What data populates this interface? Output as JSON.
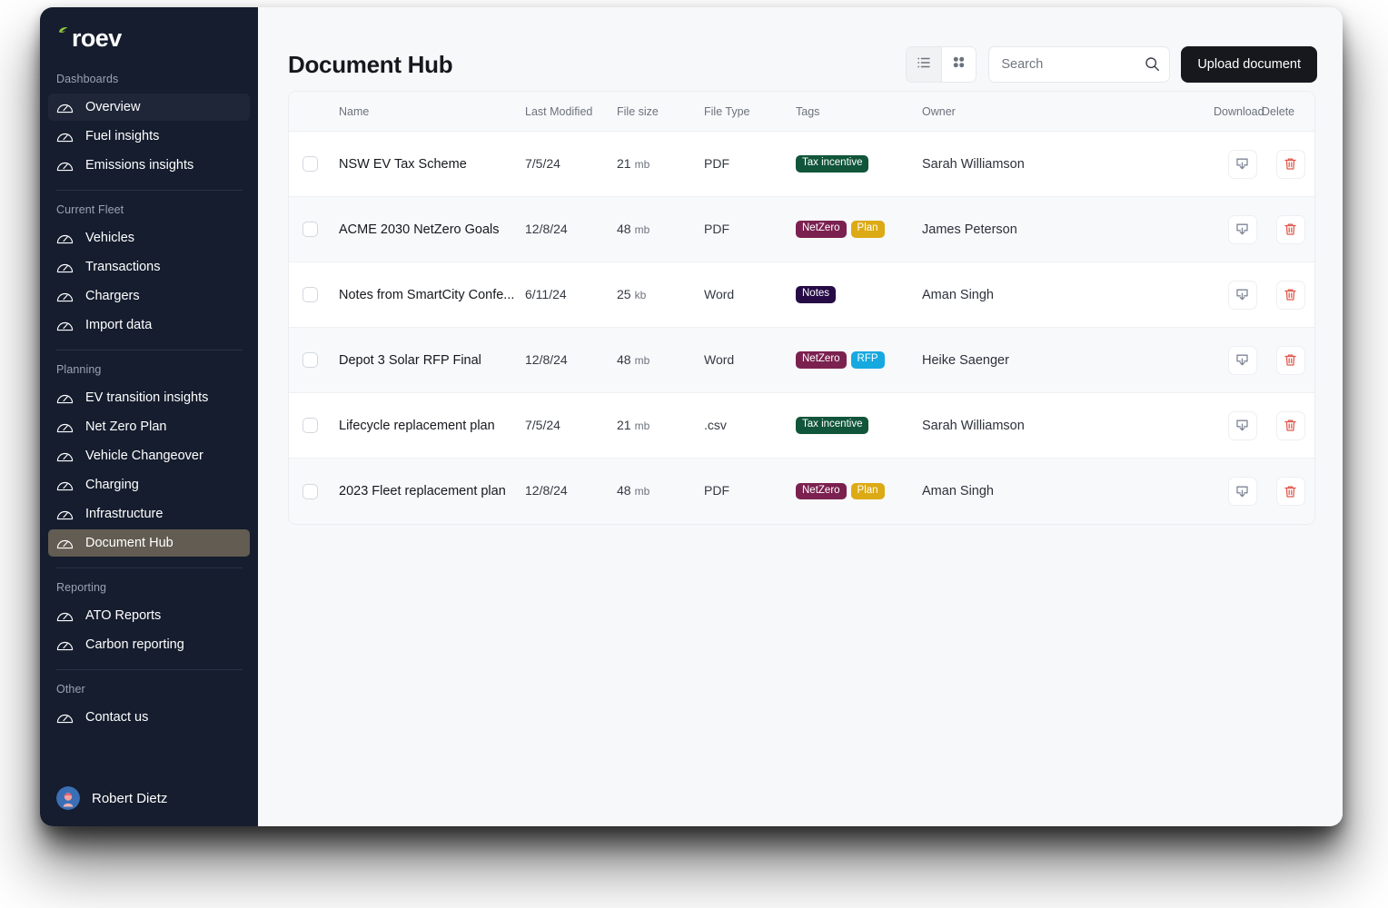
{
  "brand": {
    "name": "roev",
    "leaf_color": "#8ec63f"
  },
  "sidebar": {
    "sections": [
      {
        "label": "Dashboards",
        "items": [
          {
            "label": "Overview",
            "icon": "gauge-icon",
            "state": "active-dark"
          },
          {
            "label": "Fuel insights",
            "icon": "gauge-icon",
            "state": ""
          },
          {
            "label": "Emissions insights",
            "icon": "gauge-icon",
            "state": ""
          }
        ]
      },
      {
        "label": "Current Fleet",
        "items": [
          {
            "label": "Vehicles",
            "icon": "gauge-icon",
            "state": ""
          },
          {
            "label": "Transactions",
            "icon": "gauge-icon",
            "state": ""
          },
          {
            "label": "Chargers",
            "icon": "gauge-icon",
            "state": ""
          },
          {
            "label": "Import data",
            "icon": "gauge-icon",
            "state": ""
          }
        ]
      },
      {
        "label": "Planning",
        "items": [
          {
            "label": "EV transition insights",
            "icon": "gauge-icon",
            "state": ""
          },
          {
            "label": "Net Zero Plan",
            "icon": "gauge-icon",
            "state": ""
          },
          {
            "label": "Vehicle Changeover",
            "icon": "gauge-icon",
            "state": ""
          },
          {
            "label": "Charging",
            "icon": "gauge-icon",
            "state": ""
          },
          {
            "label": "Infrastructure",
            "icon": "gauge-icon",
            "state": ""
          },
          {
            "label": "Document Hub",
            "icon": "gauge-icon",
            "state": "active-light"
          }
        ]
      },
      {
        "label": "Reporting",
        "items": [
          {
            "label": "ATO Reports",
            "icon": "gauge-icon",
            "state": ""
          },
          {
            "label": "Carbon reporting",
            "icon": "gauge-icon",
            "state": ""
          }
        ]
      },
      {
        "label": "Other",
        "items": [
          {
            "label": "Contact us",
            "icon": "gauge-icon",
            "state": ""
          }
        ]
      }
    ],
    "user": {
      "name": "Robert Dietz",
      "avatar": "user-avatar"
    }
  },
  "header": {
    "title": "Document Hub",
    "view_toggle": [
      {
        "icon": "list-view-icon",
        "selected": true
      },
      {
        "icon": "grid-view-icon",
        "selected": false
      }
    ],
    "search": {
      "value": "",
      "placeholder": "Search",
      "icon": "search-icon"
    },
    "upload_button": "Upload document"
  },
  "table": {
    "columns": [
      "Name",
      "Last Modified",
      "File size",
      "File Type",
      "Tags",
      "Owner",
      "Download",
      "Delete"
    ],
    "rows": [
      {
        "name": "NSW EV Tax Scheme",
        "modified": "7/5/24",
        "size_value": "21",
        "size_unit": "mb",
        "type": "PDF",
        "tags": [
          {
            "label": "Tax incentive",
            "color": "#11553a"
          }
        ],
        "owner": "Sarah Williamson",
        "download_icon": "download-icon",
        "delete_icon": "trash-icon"
      },
      {
        "name": "ACME 2030 NetZero Goals",
        "modified": "12/8/24",
        "size_value": "48",
        "size_unit": "mb",
        "type": "PDF",
        "tags": [
          {
            "label": "NetZero",
            "color": "#7b2150"
          },
          {
            "label": "Plan",
            "color": "#dcaa15"
          }
        ],
        "owner": "James Peterson",
        "download_icon": "download-icon",
        "delete_icon": "trash-icon"
      },
      {
        "name": "Notes from SmartCity Confe...",
        "modified": "6/11/24",
        "size_value": "25",
        "size_unit": "kb",
        "type": "Word",
        "tags": [
          {
            "label": "Notes",
            "color": "#270b47"
          }
        ],
        "owner": "Aman Singh",
        "download_icon": "download-icon",
        "delete_icon": "trash-icon"
      },
      {
        "name": "Depot 3 Solar RFP Final",
        "modified": "12/8/24",
        "size_value": "48",
        "size_unit": "mb",
        "type": "Word",
        "tags": [
          {
            "label": "NetZero",
            "color": "#7b2150"
          },
          {
            "label": "RFP",
            "color": "#15a9e0"
          }
        ],
        "owner": "Heike Saenger",
        "download_icon": "download-icon",
        "delete_icon": "trash-icon"
      },
      {
        "name": "Lifecycle replacement plan",
        "modified": "7/5/24",
        "size_value": "21",
        "size_unit": "mb",
        "type": ".csv",
        "tags": [
          {
            "label": "Tax incentive",
            "color": "#11553a"
          }
        ],
        "owner": "Sarah Williamson",
        "download_icon": "download-icon",
        "delete_icon": "trash-icon"
      },
      {
        "name": "2023 Fleet replacement plan",
        "modified": "12/8/24",
        "size_value": "48",
        "size_unit": "mb",
        "type": "PDF",
        "tags": [
          {
            "label": "NetZero",
            "color": "#7b2150"
          },
          {
            "label": "Plan",
            "color": "#dcaa15"
          }
        ],
        "owner": "Aman Singh",
        "download_icon": "download-icon",
        "delete_icon": "trash-icon"
      }
    ]
  },
  "colors": {
    "sidebar_bg": "#151d2e",
    "accent_dark": "#16181d",
    "content_bg": "#f7f8fa",
    "brand_green": "#8ec63f"
  }
}
